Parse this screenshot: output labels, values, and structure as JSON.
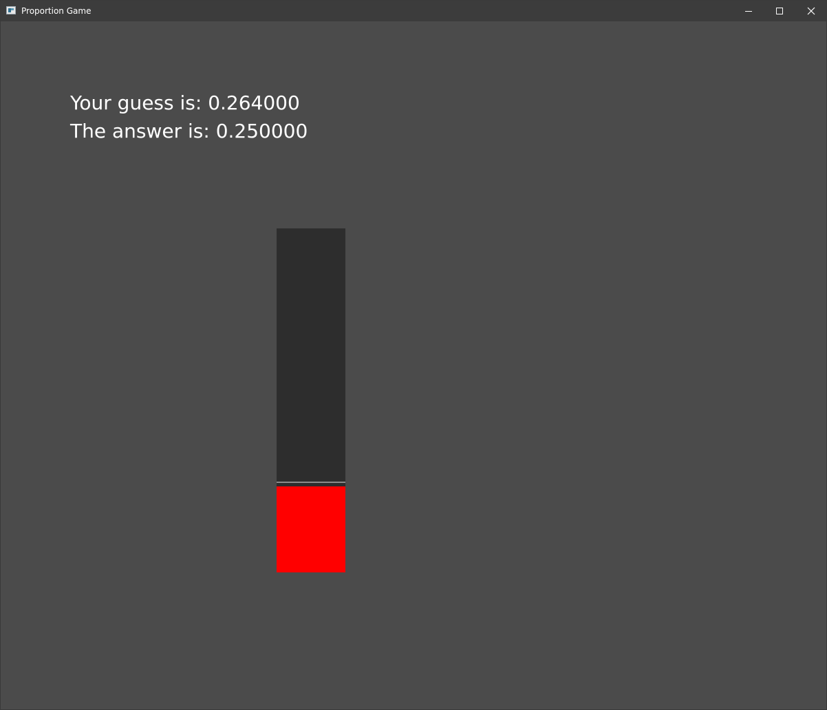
{
  "window": {
    "title": "Proportion Game"
  },
  "icons": {
    "app": "app-window-icon",
    "minimize": "minimize-icon",
    "maximize": "maximize-icon",
    "close": "close-icon"
  },
  "results": {
    "guess_line": "Your guess is: 0.264000",
    "answer_line": "The answer is: 0.250000",
    "guess_value": 0.264,
    "answer_value": 0.25
  },
  "colors": {
    "background": "#4b4b4b",
    "titlebar": "#3c3c3c",
    "track": "#2d2d2d",
    "fill": "#ff0000",
    "marker": "#8a8a8a",
    "text": "#ffffff"
  }
}
